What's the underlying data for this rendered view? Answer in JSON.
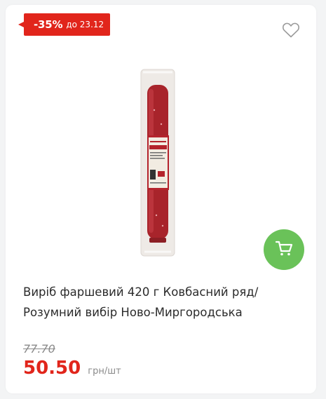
{
  "badge": {
    "discount": "-35%",
    "until": "до 23.12"
  },
  "icons": {
    "favorite": "heart-outline-icon",
    "cart": "shopping-cart-icon"
  },
  "product": {
    "title": "Виріб фаршевий 420 г Ковбасний ряд/Розумний вибір Ново-Миргородська",
    "old_price": "77.70",
    "price": "50.50",
    "unit": "грн/шт"
  },
  "colors": {
    "accent_red": "#e1251b",
    "cart_green": "#6ac259",
    "text_dark": "#2b2b2b",
    "text_muted": "#8a8a8a"
  }
}
